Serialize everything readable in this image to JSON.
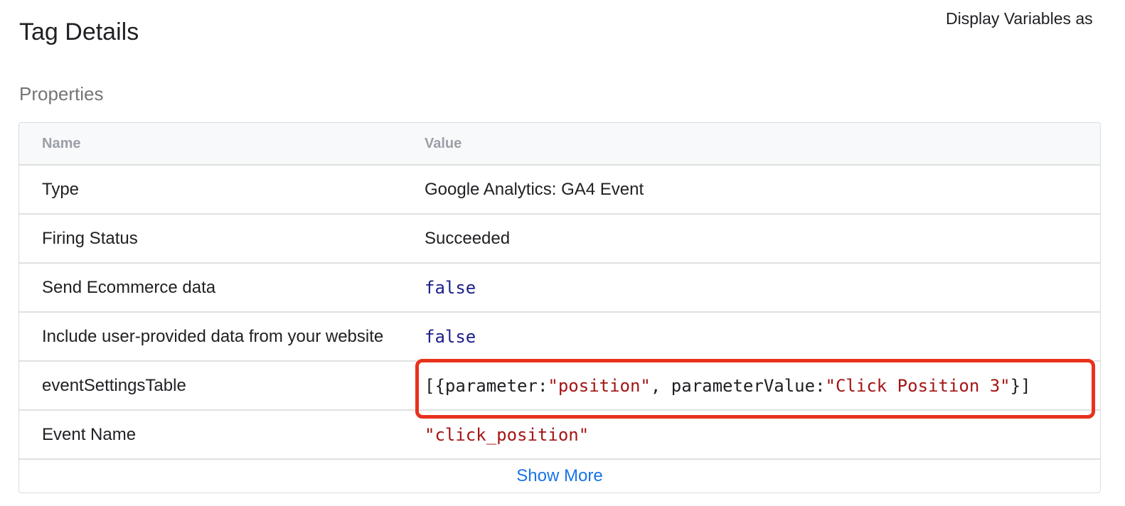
{
  "header": {
    "title": "Tag Details",
    "display_variables_label": "Display Variables as"
  },
  "section": {
    "title": "Properties"
  },
  "table": {
    "columns": [
      "Name",
      "Value"
    ],
    "rows": [
      {
        "name": "Type",
        "value": "Google Analytics: GA4 Event",
        "kind": "text"
      },
      {
        "name": "Firing Status",
        "value": "Succeeded",
        "kind": "text"
      },
      {
        "name": "Send Ecommerce data",
        "value": "false",
        "kind": "keyword"
      },
      {
        "name": "Include user-provided data from your website",
        "value": "false",
        "kind": "keyword"
      },
      {
        "name": "eventSettingsTable",
        "value_parts": [
          "[{parameter: ",
          "\"position\"",
          ", parameterValue: ",
          "\"Click Position 3\"",
          "}]"
        ],
        "kind": "code",
        "highlighted": true
      },
      {
        "name": "Event Name",
        "value": "\"click_position\"",
        "kind": "string"
      }
    ],
    "show_more_label": "Show More"
  },
  "colors": {
    "keyword": "#1c1e8a",
    "string": "#a31515",
    "link": "#1a73e8",
    "highlight_border": "#e8321c"
  }
}
